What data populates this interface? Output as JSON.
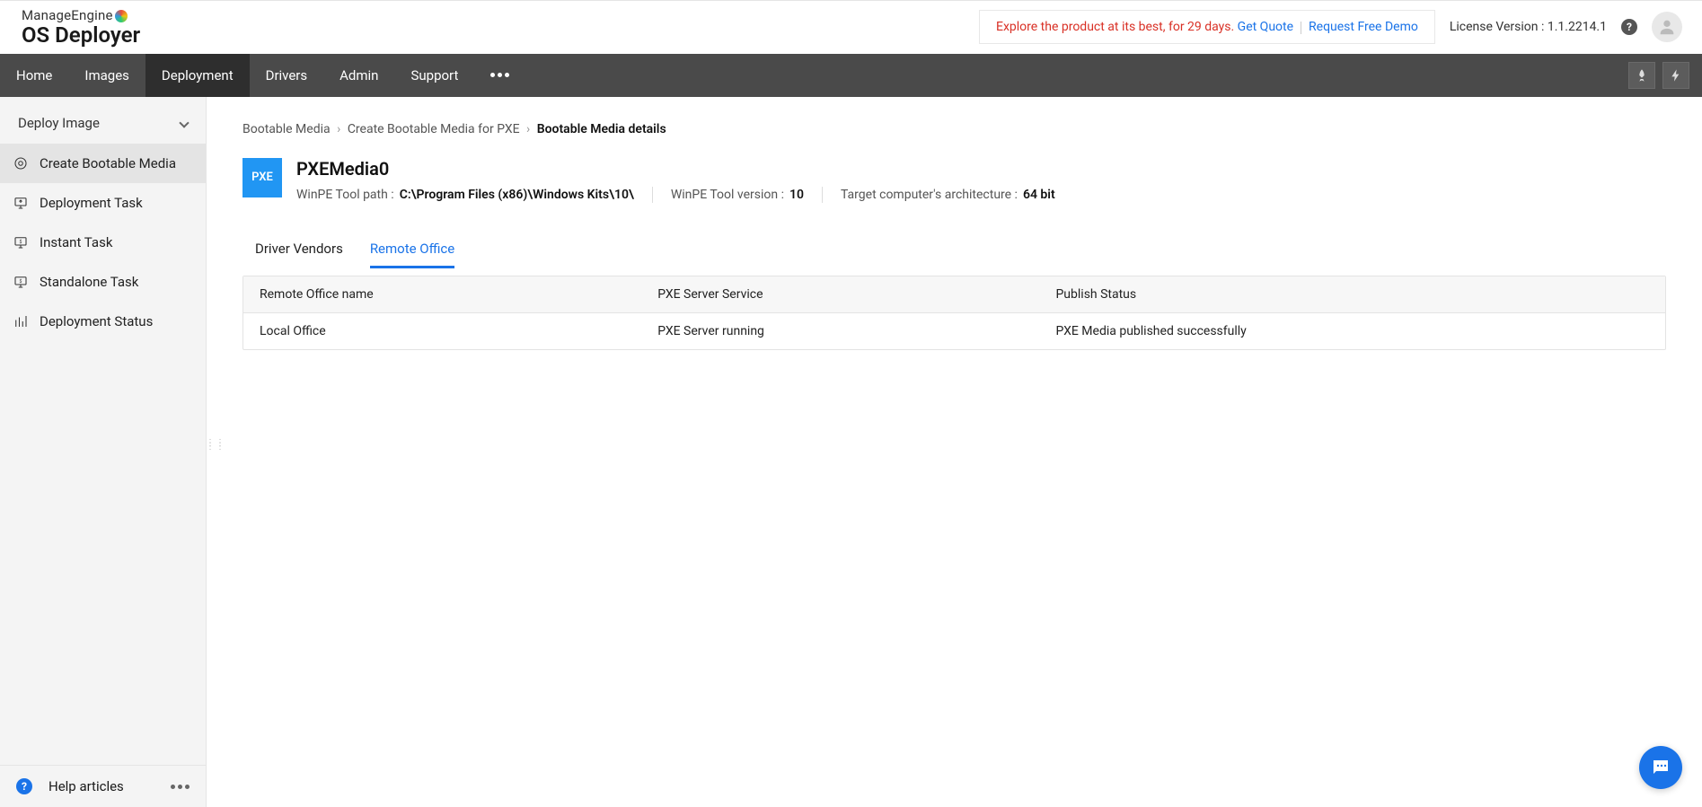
{
  "brand": {
    "line1": "ManageEngine",
    "line2": "OS Deployer"
  },
  "trial": {
    "text": "Explore the product at its best, for 29 days. ",
    "get_quote": "Get Quote",
    "request_demo": "Request Free Demo"
  },
  "license": {
    "label": "License  Version : 1.1.2214.1"
  },
  "nav": {
    "items": [
      "Home",
      "Images",
      "Deployment",
      "Drivers",
      "Admin",
      "Support"
    ],
    "active": "Deployment"
  },
  "sidebar": {
    "group": "Deploy Image",
    "items": [
      {
        "label": "Create Bootable Media",
        "active": true
      },
      {
        "label": "Deployment Task",
        "active": false
      },
      {
        "label": "Instant Task",
        "active": false
      },
      {
        "label": "Standalone Task",
        "active": false
      },
      {
        "label": "Deployment Status",
        "active": false
      }
    ],
    "help": "Help articles"
  },
  "crumbs": {
    "a": "Bootable Media",
    "b": "Create Bootable Media for PXE",
    "c": "Bootable Media details"
  },
  "details": {
    "badge": "PXE",
    "title": "PXEMedia0",
    "meta": [
      {
        "label": "WinPE Tool path :",
        "value": "C:\\Program Files (x86)\\Windows Kits\\10\\"
      },
      {
        "label": "WinPE Tool version :",
        "value": "10"
      },
      {
        "label": "Target computer's architecture :",
        "value": "64 bit"
      }
    ]
  },
  "tabs": {
    "items": [
      "Driver Vendors",
      "Remote Office"
    ],
    "active": "Remote Office"
  },
  "table": {
    "headers": [
      "Remote Office name",
      "PXE Server Service",
      "Publish Status"
    ],
    "rows": [
      [
        "Local Office",
        "PXE Server running",
        "PXE Media published successfully"
      ]
    ]
  }
}
